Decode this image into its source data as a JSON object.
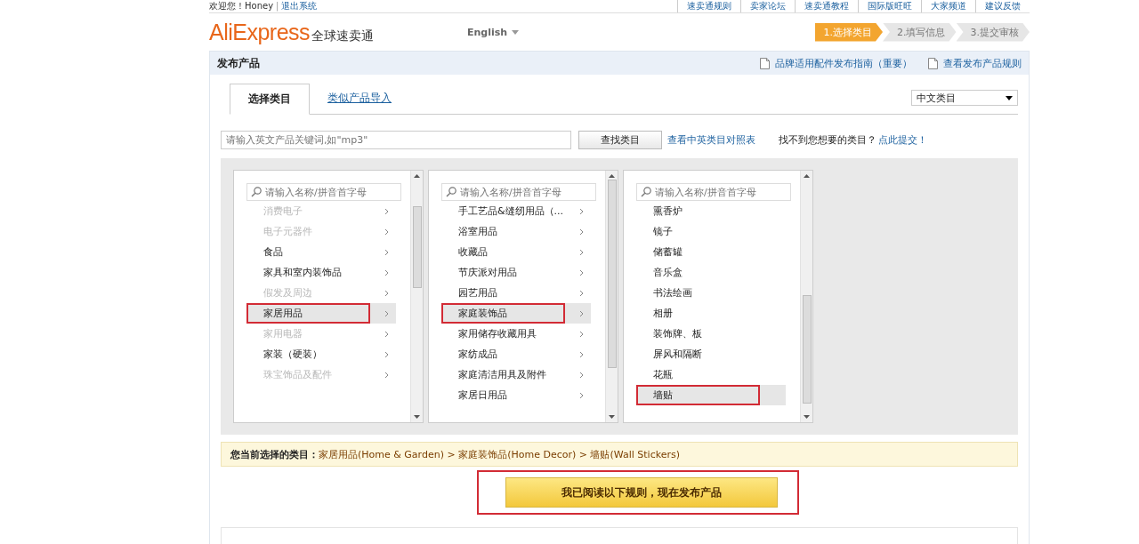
{
  "top_bar": {
    "greeting": "欢迎您！Honey",
    "separator": "|",
    "logout": "退出系统",
    "links": [
      "速卖通规则",
      "卖家论坛",
      "速卖通教程",
      "国际版旺旺",
      "大家频道",
      "建议反馈"
    ]
  },
  "header": {
    "logo": "AliExpress",
    "logo_cn": "全球速卖通",
    "language": "English",
    "steps": [
      {
        "label": "1.选择类目",
        "selected": true
      },
      {
        "label": "2.填写信息",
        "selected": false
      },
      {
        "label": "3.提交审核",
        "selected": false
      }
    ]
  },
  "panel": {
    "title": "发布产品",
    "links": [
      "品牌适用配件发布指南（重要）",
      "查看发布产品规则"
    ]
  },
  "tabs": [
    {
      "label": "选择类目",
      "selected": true
    },
    {
      "label": "类似产品导入",
      "selected": false
    }
  ],
  "language_select": {
    "value": "中文类目"
  },
  "search": {
    "placeholder": "请输入英文产品关键词,如\"mp3\"",
    "button": "查找类目",
    "mapping_link": "查看中英类目对照表",
    "hint": "找不到您想要的类目？",
    "submit_link": "点此提交！"
  },
  "columns": [
    {
      "placeholder": "请输入名称/拼音首字母",
      "arrows": true,
      "items": [
        {
          "label": "消费电子",
          "disabled": true,
          "selected": false,
          "annotated": false
        },
        {
          "label": "电子元器件",
          "disabled": true,
          "selected": false,
          "annotated": false
        },
        {
          "label": "食品",
          "disabled": false,
          "selected": false,
          "annotated": false
        },
        {
          "label": "家具和室内装饰品",
          "disabled": false,
          "selected": false,
          "annotated": false
        },
        {
          "label": "假发及周边",
          "disabled": true,
          "selected": false,
          "annotated": false
        },
        {
          "label": "家居用品",
          "disabled": false,
          "selected": true,
          "annotated": true
        },
        {
          "label": "家用电器",
          "disabled": true,
          "selected": false,
          "annotated": false
        },
        {
          "label": "家装（硬装）",
          "disabled": false,
          "selected": false,
          "annotated": false
        },
        {
          "label": "珠宝饰品及配件",
          "disabled": true,
          "selected": false,
          "annotated": false
        }
      ]
    },
    {
      "placeholder": "请输入名称/拼音首字母",
      "arrows": true,
      "items": [
        {
          "label": "手工艺品&缝纫用品（...",
          "disabled": false,
          "selected": false,
          "annotated": false
        },
        {
          "label": "浴室用品",
          "disabled": false,
          "selected": false,
          "annotated": false
        },
        {
          "label": "收藏品",
          "disabled": false,
          "selected": false,
          "annotated": false
        },
        {
          "label": "节庆派对用品",
          "disabled": false,
          "selected": false,
          "annotated": false
        },
        {
          "label": "园艺用品",
          "disabled": false,
          "selected": false,
          "annotated": false
        },
        {
          "label": "家庭装饰品",
          "disabled": false,
          "selected": true,
          "annotated": true
        },
        {
          "label": "家用储存收藏用具",
          "disabled": false,
          "selected": false,
          "annotated": false
        },
        {
          "label": "家纺成品",
          "disabled": false,
          "selected": false,
          "annotated": false
        },
        {
          "label": "家庭清洁用具及附件",
          "disabled": false,
          "selected": false,
          "annotated": false
        },
        {
          "label": "家居日用品",
          "disabled": false,
          "selected": false,
          "annotated": false
        }
      ]
    },
    {
      "placeholder": "请输入名称/拼音首字母",
      "arrows": false,
      "items": [
        {
          "label": "熏香炉",
          "disabled": false,
          "selected": false,
          "annotated": false
        },
        {
          "label": "镜子",
          "disabled": false,
          "selected": false,
          "annotated": false
        },
        {
          "label": "储蓄罐",
          "disabled": false,
          "selected": false,
          "annotated": false
        },
        {
          "label": "音乐盒",
          "disabled": false,
          "selected": false,
          "annotated": false
        },
        {
          "label": "书法绘画",
          "disabled": false,
          "selected": false,
          "annotated": false
        },
        {
          "label": "相册",
          "disabled": false,
          "selected": false,
          "annotated": false
        },
        {
          "label": "装饰牌、板",
          "disabled": false,
          "selected": false,
          "annotated": false
        },
        {
          "label": "屏风和隔断",
          "disabled": false,
          "selected": false,
          "annotated": false
        },
        {
          "label": "花瓶",
          "disabled": false,
          "selected": false,
          "annotated": false
        },
        {
          "label": "墙贴",
          "disabled": false,
          "selected": true,
          "annotated": true
        }
      ]
    }
  ],
  "current_selection": {
    "label": "您当前选择的类目：",
    "path": "家居用品(Home & Garden) > 家庭装饰品(Home Decor) > 墙贴(Wall Stickers)"
  },
  "publish_button": {
    "label": "我已阅读以下规则，现在发布产品",
    "annotated": true
  }
}
